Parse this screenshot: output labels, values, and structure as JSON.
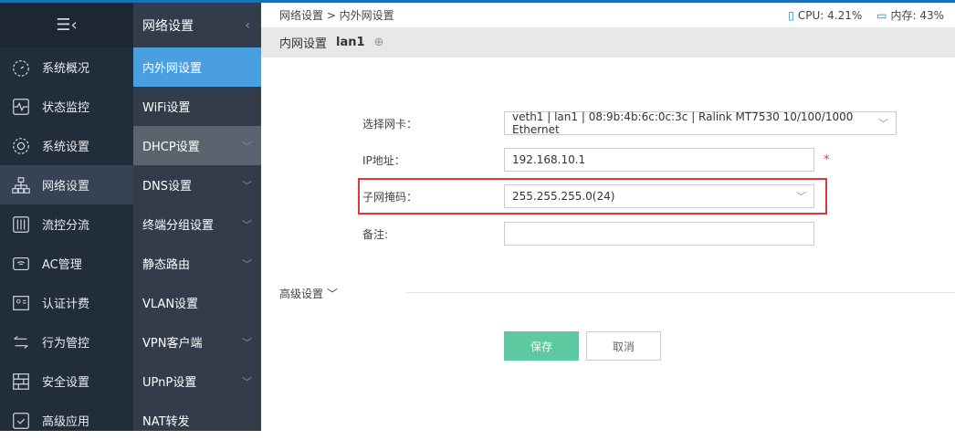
{
  "nav_primary": {
    "toggle_icon": "menu-collapse-icon",
    "items": [
      {
        "label": "系统概况",
        "icon": "dashboard"
      },
      {
        "label": "状态监控",
        "icon": "monitor"
      },
      {
        "label": "系统设置",
        "icon": "gear"
      },
      {
        "label": "网络设置",
        "icon": "network",
        "active": true
      },
      {
        "label": "流控分流",
        "icon": "sliders"
      },
      {
        "label": "AC管理",
        "icon": "wifi"
      },
      {
        "label": "认证计费",
        "icon": "id-card"
      },
      {
        "label": "行为管控",
        "icon": "arrows"
      },
      {
        "label": "安全设置",
        "icon": "firewall"
      },
      {
        "label": "高级应用",
        "icon": "check-box"
      }
    ]
  },
  "nav_secondary": {
    "title": "网络设置",
    "items": [
      {
        "label": "内外网设置",
        "active": true
      },
      {
        "label": "WiFi设置"
      },
      {
        "label": "DHCP设置",
        "expand": true,
        "hover": true
      },
      {
        "label": "DNS设置",
        "expand": true
      },
      {
        "label": "终端分组设置",
        "expand": true
      },
      {
        "label": "静态路由",
        "expand": true
      },
      {
        "label": "VLAN设置"
      },
      {
        "label": "VPN客户端",
        "expand": true
      },
      {
        "label": "UPnP设置",
        "expand": true
      },
      {
        "label": "NAT转发"
      }
    ]
  },
  "breadcrumb": "网络设置 > 内外网设置",
  "stats": {
    "cpu": "CPU: 4.21%",
    "mem": "内存: 43%"
  },
  "title": {
    "label": "内网设置",
    "iface": "lan1"
  },
  "form": {
    "nic_label": "选择网卡：",
    "nic_value": "veth1 | lan1 | 08:9b:4b:6c:0c:3c | Ralink MT7530 10/100/1000 Ethernet",
    "ip_label": "IP地址：",
    "ip_value": "192.168.10.1",
    "required": "*",
    "mask_label": "子网掩码：",
    "mask_value": "255.255.255.0(24)",
    "note_label": "备注:",
    "note_value": ""
  },
  "advanced": "高级设置 ﹀",
  "buttons": {
    "save": "保存",
    "cancel": "取消"
  }
}
